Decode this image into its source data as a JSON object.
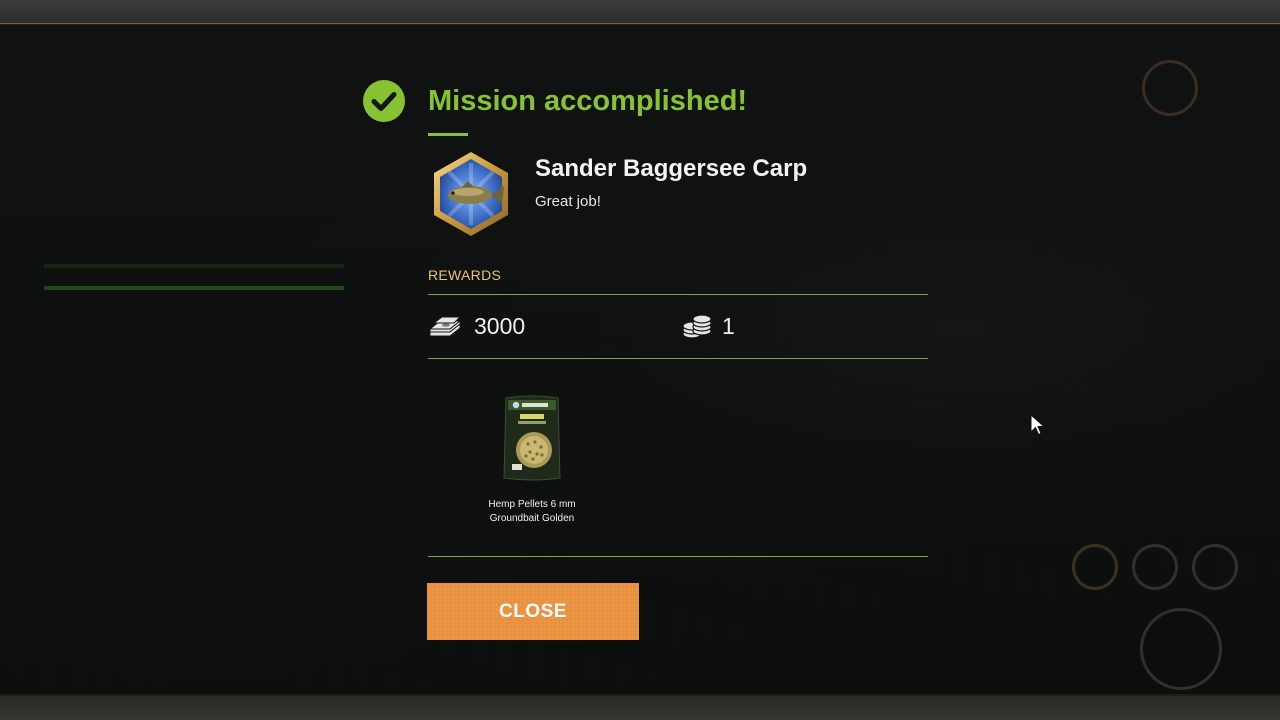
{
  "dialog": {
    "title": "Mission accomplished!",
    "mission_name": "Sander Baggersee Carp",
    "subtitle": "Great job!",
    "rewards_label": "REWARDS",
    "rewards": {
      "cash_icon": "money-stack-icon",
      "cash_value": "3000",
      "coin_icon": "coin-stack-icon",
      "coin_value": "1"
    },
    "item": {
      "icon": "hemp-pellets-bag-icon",
      "name_line1": "Hemp Pellets 6 mm",
      "name_line2": "Groundbait Golden"
    },
    "close_label": "CLOSE"
  },
  "colors": {
    "accent_green": "#86c232",
    "rewards_gold": "#e8c574",
    "button_orange": "#e8913f",
    "divider_green": "#7fa33d"
  }
}
